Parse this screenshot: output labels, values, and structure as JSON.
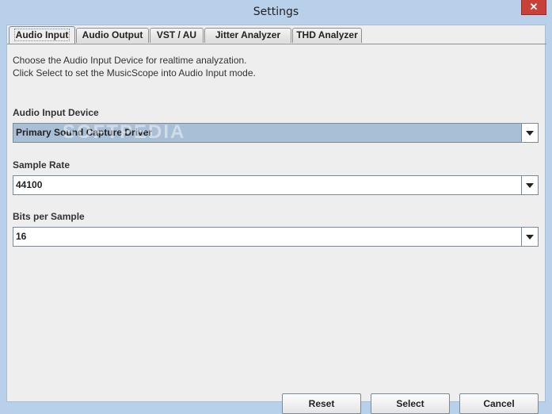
{
  "window": {
    "title": "Settings",
    "close_label": "✕"
  },
  "tabs": [
    {
      "label": "Audio Input",
      "active": true
    },
    {
      "label": "Audio Output"
    },
    {
      "label": "VST / AU"
    },
    {
      "label": "Jitter Analyzer"
    },
    {
      "label": "THD Analyzer"
    }
  ],
  "panel": {
    "description_line1": "Choose the Audio Input Device for realtime analyzation.",
    "description_line2": "Click Select to set the MusicScope into Audio Input mode.",
    "device": {
      "label": "Audio Input Device",
      "value": "Primary Sound Capture Driver"
    },
    "sample_rate": {
      "label": "Sample Rate",
      "value": "44100"
    },
    "bits": {
      "label": "Bits per Sample",
      "value": "16"
    },
    "watermark": "SOFTPEDIA"
  },
  "buttons": {
    "reset": "Reset",
    "select": "Select",
    "cancel": "Cancel"
  },
  "colors": {
    "titlebar": "#b8d0ea",
    "client": "#eeeeee",
    "selection": "#a9bfd6",
    "close": "#c7413a"
  }
}
